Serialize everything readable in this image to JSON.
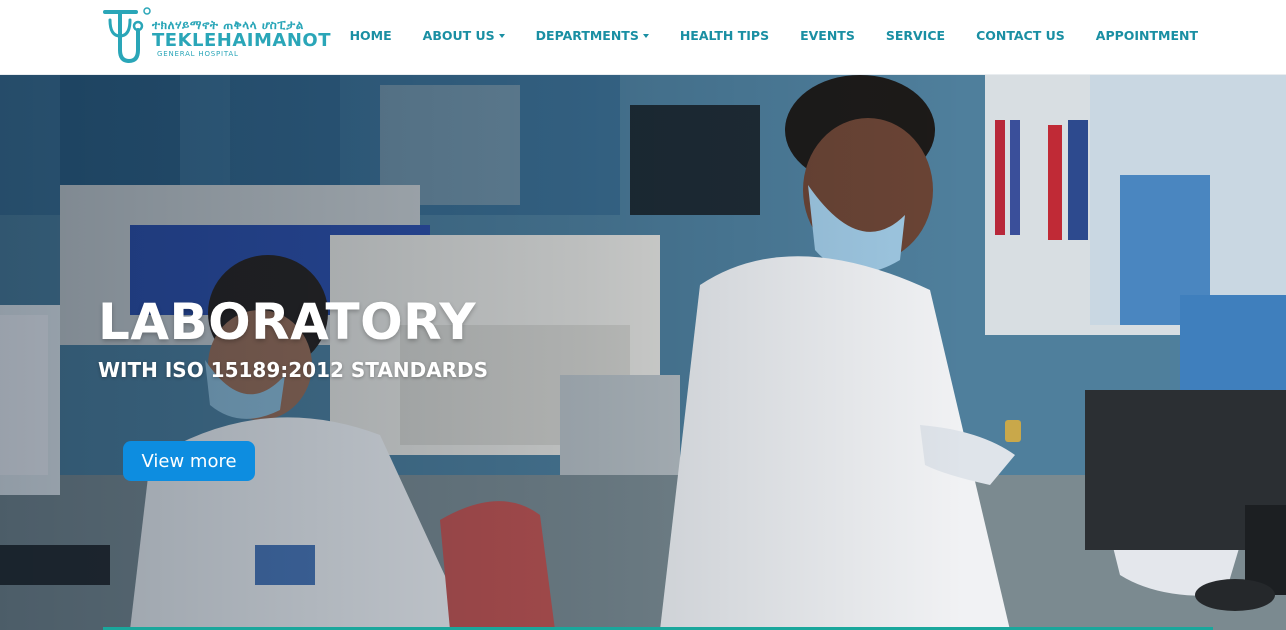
{
  "header": {
    "logo": {
      "amharic": "ተክለሃይማኖት ጠቅላላ ሆስፒታል",
      "name": "TEKLEHAIMANOT",
      "subtitle": "GENERAL HOSPITAL",
      "icon": "stethoscope-t-icon"
    },
    "nav": [
      {
        "label": "HOME",
        "dropdown": false
      },
      {
        "label": "ABOUT US",
        "dropdown": true
      },
      {
        "label": "DEPARTMENTS",
        "dropdown": true
      },
      {
        "label": "HEALTH TIPS",
        "dropdown": false
      },
      {
        "label": "EVENTS",
        "dropdown": false
      },
      {
        "label": "SERVICE",
        "dropdown": false
      },
      {
        "label": "CONTACT US",
        "dropdown": false
      },
      {
        "label": "APPOINTMENT",
        "dropdown": false
      }
    ]
  },
  "hero": {
    "title": "LABORATORY",
    "subtitle": "WITH ISO 15189:2012 STANDARDS",
    "button_label": "View more"
  },
  "colors": {
    "brand_teal": "#2aa6b8",
    "nav_text": "#1a8fa3",
    "button_blue": "#0d8de0",
    "progress_green": "#1aa79c"
  }
}
